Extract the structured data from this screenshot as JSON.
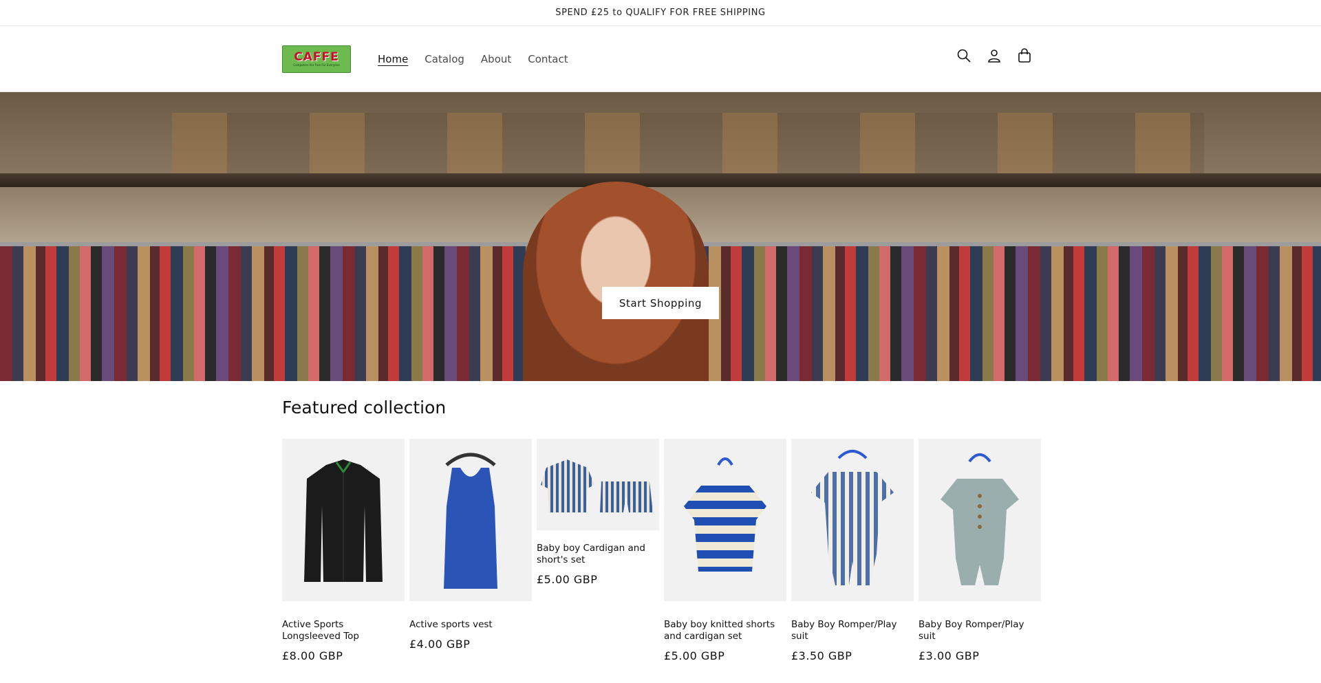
{
  "announcement": {
    "text": "SPEND £25 to QUALIFY FOR FREE SHIPPING"
  },
  "header": {
    "logo": {
      "word": "CAFFE",
      "tagline": "Computers Are Free For Everyone"
    },
    "nav": [
      {
        "label": "Home",
        "active": true
      },
      {
        "label": "Catalog",
        "active": false
      },
      {
        "label": "About",
        "active": false
      },
      {
        "label": "Contact",
        "active": false
      }
    ],
    "icons": [
      "search-icon",
      "account-icon",
      "cart-icon"
    ]
  },
  "hero": {
    "button_label": "Start Shopping"
  },
  "featured": {
    "title": "Featured collection",
    "products": [
      {
        "name": "Active Sports Longsleeved Top",
        "price": "£8.00 GBP",
        "image": "black zip jacket",
        "color": "#1b1b1b"
      },
      {
        "name": "Active sports vest",
        "price": "£4.00 GBP",
        "image": "blue vest",
        "color": "#2a54b5"
      },
      {
        "name": "Baby boy Cardigan and short's set",
        "price": "£5.00 GBP",
        "image": "striped cardigan and shorts",
        "color": "#5a76a8"
      },
      {
        "name": "Baby boy knitted shorts and cardigan set",
        "price": "£5.00 GBP",
        "image": "blue striped knitted cardigan",
        "color": "#1f4fb3"
      },
      {
        "name": "Baby Boy Romper/Play suit",
        "price": "£3.50 GBP",
        "image": "blue striped romper",
        "color": "#4e6fa6"
      },
      {
        "name": "Baby Boy Romper/Play suit",
        "price": "£3.00 GBP",
        "image": "sage green romper",
        "color": "#9aaeae"
      }
    ]
  }
}
